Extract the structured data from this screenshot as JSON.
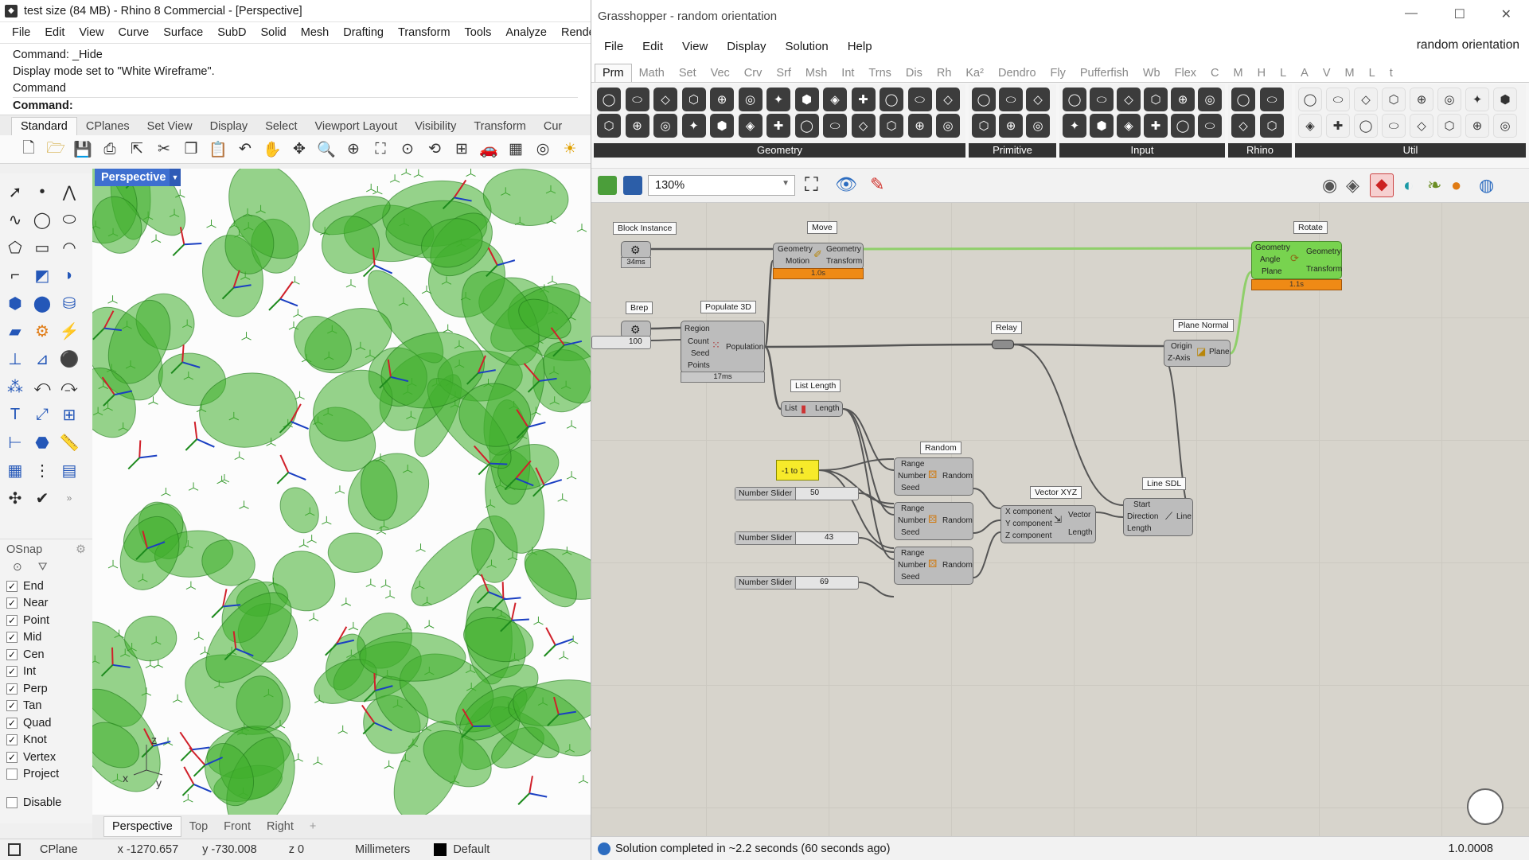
{
  "rhino": {
    "title": "test size (84 MB) - Rhino 8 Commercial - [Perspective]",
    "menu": [
      "File",
      "Edit",
      "View",
      "Curve",
      "Surface",
      "SubD",
      "Solid",
      "Mesh",
      "Drafting",
      "Transform",
      "Tools",
      "Analyze",
      "Render"
    ],
    "command_history": [
      "Command: _Hide",
      "Display mode set to \"White Wireframe\".",
      "Command"
    ],
    "command_prompt": "Command:",
    "toolbar_tabs": [
      "Standard",
      "CPlanes",
      "Set View",
      "Display",
      "Select",
      "Viewport Layout",
      "Visibility",
      "Transform",
      "Cur"
    ],
    "active_toolbar_tab": "Standard",
    "viewport_title": "Perspective",
    "axis_labels": {
      "z": "z",
      "x": "x",
      "y": "y"
    },
    "osnap": {
      "title": "OSnap",
      "items": [
        {
          "label": "End",
          "checked": true
        },
        {
          "label": "Near",
          "checked": true
        },
        {
          "label": "Point",
          "checked": true
        },
        {
          "label": "Mid",
          "checked": true
        },
        {
          "label": "Cen",
          "checked": true
        },
        {
          "label": "Int",
          "checked": true
        },
        {
          "label": "Perp",
          "checked": true
        },
        {
          "label": "Tan",
          "checked": true
        },
        {
          "label": "Quad",
          "checked": true
        },
        {
          "label": "Knot",
          "checked": true
        },
        {
          "label": "Vertex",
          "checked": true
        },
        {
          "label": "Project",
          "checked": false
        }
      ],
      "disable_label": "Disable"
    },
    "view_tabs": [
      "Perspective",
      "Top",
      "Front",
      "Right"
    ],
    "status": {
      "cplane": "CPlane",
      "x": "x -1270.657",
      "y": "y -730.008",
      "z": "z 0",
      "units": "Millimeters",
      "layer": "Default"
    }
  },
  "gh": {
    "title": "Grasshopper - random orientation",
    "menu": [
      "File",
      "Edit",
      "View",
      "Display",
      "Solution",
      "Help"
    ],
    "doc_name": "random orientation",
    "tabs": [
      "Prm",
      "Math",
      "Set",
      "Vec",
      "Crv",
      "Srf",
      "Msh",
      "Int",
      "Trns",
      "Dis",
      "Rh",
      "Ka²",
      "Dendro",
      "Fly",
      "Pufferfish",
      "Wb",
      "Flex",
      "C",
      "M",
      "H",
      "L",
      "A",
      "V",
      "M",
      "L",
      "t"
    ],
    "active_tab": "Prm",
    "panels": [
      "Geometry",
      "Primitive",
      "Input",
      "Rhino",
      "Util"
    ],
    "zoom": "130%",
    "status": "Solution completed in ~2.2 seconds (60 seconds ago)",
    "version": "1.0.0008",
    "nodes": {
      "block_instance": {
        "label": "Block Instance",
        "time": "34ms"
      },
      "brep": {
        "label": "Brep",
        "value": "100"
      },
      "populate3d": {
        "label": "Populate 3D",
        "inputs": [
          "Region",
          "Count",
          "Seed",
          "Points"
        ],
        "output": "Population",
        "time": "17ms"
      },
      "move": {
        "label": "Move",
        "inputs": [
          "Geometry",
          "Motion"
        ],
        "outputs": [
          "Geometry",
          "Transform"
        ],
        "time": "1.0s"
      },
      "list_length": {
        "label": "List Length",
        "input": "List",
        "output": "Length"
      },
      "relay": {
        "label": "Relay"
      },
      "plane_normal": {
        "label": "Plane Normal",
        "inputs": [
          "Origin",
          "Z-Axis"
        ],
        "output": "Plane"
      },
      "rotate": {
        "label": "Rotate",
        "inputs": [
          "Geometry",
          "Angle",
          "Plane"
        ],
        "outputs": [
          "Geometry",
          "Transform"
        ],
        "time": "1.1s"
      },
      "panel": {
        "text": "-1 to 1"
      },
      "random": {
        "label": "Random",
        "inputs": [
          "Range",
          "Number",
          "Seed"
        ],
        "output": "Random"
      },
      "sliders": [
        {
          "name": "Number Slider",
          "value": "50"
        },
        {
          "name": "Number Slider",
          "value": "43"
        },
        {
          "name": "Number Slider",
          "value": "69"
        }
      ],
      "vector_xyz": {
        "label": "Vector XYZ",
        "inputs": [
          "X component",
          "Y component",
          "Z component"
        ],
        "outputs": [
          "Vector",
          "Length"
        ]
      },
      "line_sdl": {
        "label": "Line SDL",
        "inputs": [
          "Start",
          "Direction",
          "Length"
        ],
        "output": "Line"
      }
    }
  },
  "colors": {
    "geometry_green": "#3fae2c",
    "gh_canvas": "#d7d4cc",
    "vp_tab": "#3e6fd0",
    "node_gray": "#bcbcbc",
    "node_green": "#78d34f",
    "time_orange": "#ef8a15"
  }
}
